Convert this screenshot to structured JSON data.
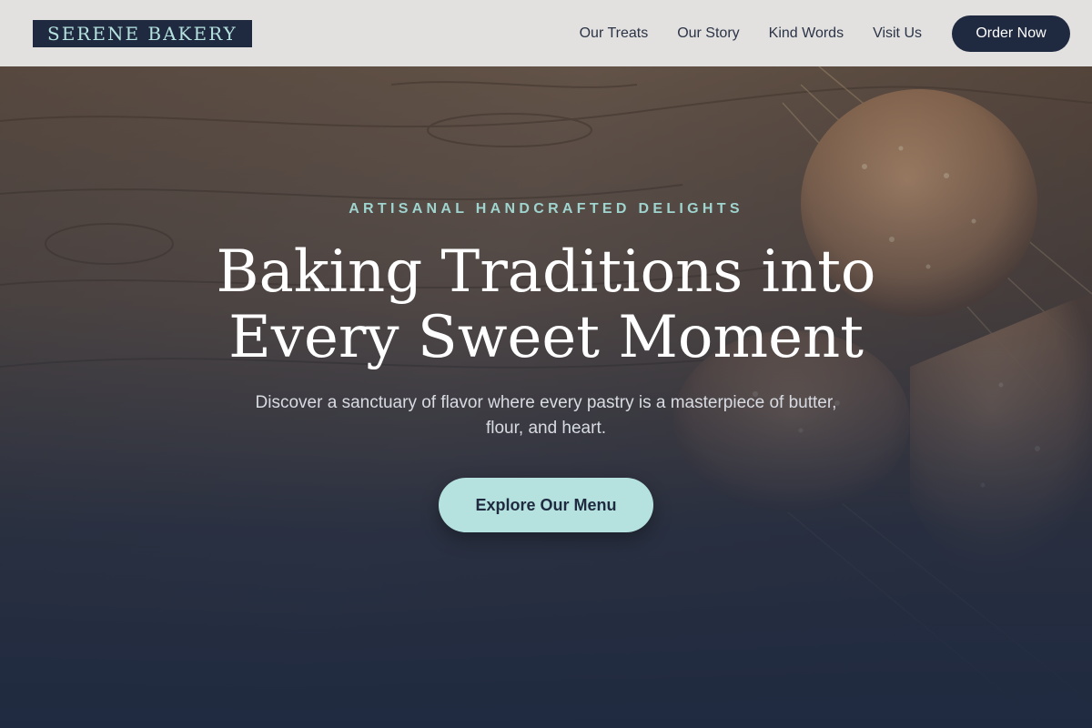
{
  "header": {
    "logo": "SERENE BAKERY",
    "nav": [
      {
        "label": "Our Treats"
      },
      {
        "label": "Our Story"
      },
      {
        "label": "Kind Words"
      },
      {
        "label": "Visit Us"
      }
    ],
    "order_label": "Order Now"
  },
  "hero": {
    "eyebrow": "ARTISANAL HANDCRAFTED DELIGHTS",
    "headline_line1": "Baking Traditions into",
    "headline_line2": "Every Sweet Moment",
    "subtext": "Discover a sanctuary of flavor where every pastry is a masterpiece of butter, flour, and heart.",
    "cta_label": "Explore Our Menu"
  },
  "colors": {
    "navy": "#1f2a40",
    "mint": "#b5e2de",
    "header_bg": "#e3e1e0",
    "wood": "#5b4a3c"
  }
}
